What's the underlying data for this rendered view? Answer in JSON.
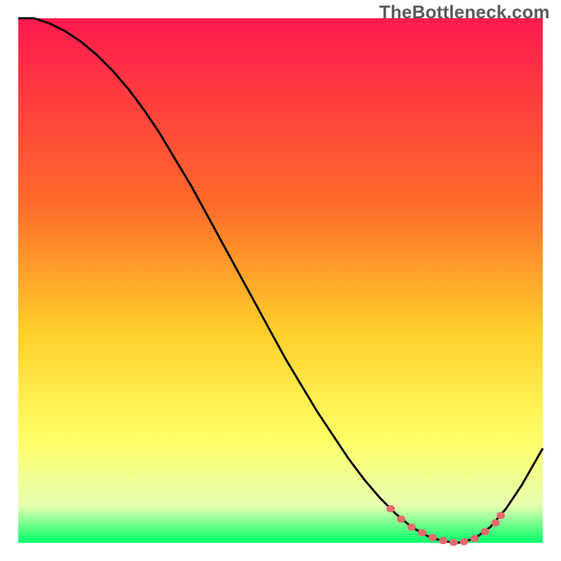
{
  "watermark": "TheBottleneck.com",
  "palette": {
    "grad_top": "#ff1a4f",
    "grad_mid1": "#ff6a2a",
    "grad_mid2": "#ffd02a",
    "grad_mid3": "#ffff66",
    "grad_mid4": "#e6ffb0",
    "grad_bottom": "#00ff6a",
    "curve_stroke": "#000000",
    "marker_fill": "#e66a6a"
  },
  "chart_data": {
    "type": "line",
    "title": "",
    "xlabel": "",
    "ylabel": "",
    "xlim": [
      0,
      100
    ],
    "ylim": [
      0,
      100
    ],
    "x": [
      0,
      3,
      6,
      9,
      12,
      15,
      18,
      21,
      24,
      27,
      30,
      33,
      36,
      39,
      42,
      45,
      48,
      51,
      54,
      57,
      60,
      63,
      66,
      69,
      72,
      75,
      78,
      81,
      84,
      87,
      90,
      93,
      96,
      100
    ],
    "values": [
      100,
      100,
      99,
      97.5,
      95.5,
      93,
      90,
      86.5,
      82.5,
      78,
      73,
      68,
      62.5,
      57,
      51.5,
      46,
      40.5,
      35,
      30,
      25,
      20.5,
      16,
      12,
      8.5,
      5.5,
      3,
      1.3,
      0.3,
      0,
      0.8,
      3,
      6.5,
      11,
      18
    ],
    "markers_x": [
      71,
      73,
      75,
      77,
      79,
      81,
      83,
      85,
      87,
      89,
      91,
      92
    ],
    "markers_y": [
      6.5,
      4.5,
      3,
      1.9,
      1,
      0.4,
      0.05,
      0.2,
      0.8,
      2.1,
      3.8,
      5.2
    ]
  }
}
